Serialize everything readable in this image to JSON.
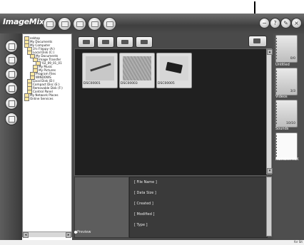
{
  "app": {
    "logo": "ImageMixer"
  },
  "toolbar": {
    "buttons": [
      "home-icon",
      "print-icon",
      "mail-icon",
      "web-icon",
      "settings-icon"
    ],
    "right_buttons": [
      "minimize",
      "help",
      "tools",
      "close"
    ]
  },
  "left_nav": [
    "album-icon",
    "camera-icon",
    "cd-icon",
    "tools-icon",
    "print-icon",
    "dvd-icon"
  ],
  "folder_tree": [
    {
      "label": "esktop",
      "indent": 0
    },
    {
      "label": "My Documents",
      "indent": 0
    },
    {
      "label": "My Computer",
      "indent": 0
    },
    {
      "label": "3½ Floppy (A:)",
      "indent": 1
    },
    {
      "label": "Local Disk (C:)",
      "indent": 1
    },
    {
      "label": "My Documents",
      "indent": 2
    },
    {
      "label": "Image Transfer",
      "indent": 3
    },
    {
      "label": "'02_09_01_01",
      "indent": 4
    },
    {
      "label": "My Music",
      "indent": 3
    },
    {
      "label": "My Pictures",
      "indent": 3
    },
    {
      "label": "Program Files",
      "indent": 2
    },
    {
      "label": "WINDOWS",
      "indent": 2
    },
    {
      "label": "Local Disk (D:)",
      "indent": 1
    },
    {
      "label": "Compact Disc (E:)",
      "indent": 1
    },
    {
      "label": "Removable Disk (F:)",
      "indent": 1
    },
    {
      "label": "Control Panel",
      "indent": 1
    },
    {
      "label": "My Network Places",
      "indent": 0
    },
    {
      "label": "Online Services",
      "indent": 0
    }
  ],
  "media_buttons": [
    "photo-icon",
    "video-icon",
    "sound-icon",
    "slideshow-icon"
  ],
  "thumbnails": [
    {
      "name": "DSC00001",
      "color": "#3a3a3a"
    },
    {
      "name": "DSC00003",
      "color": "#9a9a9a"
    },
    {
      "name": "DSC00005",
      "color": "#1e1e1e"
    }
  ],
  "preview": {
    "label": "Preview"
  },
  "info_fields": [
    "[ File Name ]",
    "[ Data Size ]",
    "[ Created ]",
    "[ Modified ]",
    "[ Type ]"
  ],
  "albums": [
    {
      "label": "Untitled",
      "count": "0/0"
    },
    {
      "label": "Videos",
      "count": "3/3"
    },
    {
      "label": "Sounds",
      "count": "10/10"
    },
    {
      "label": "MEMORY MIX",
      "count": ""
    }
  ],
  "status": {
    "text": "for Sit"
  }
}
